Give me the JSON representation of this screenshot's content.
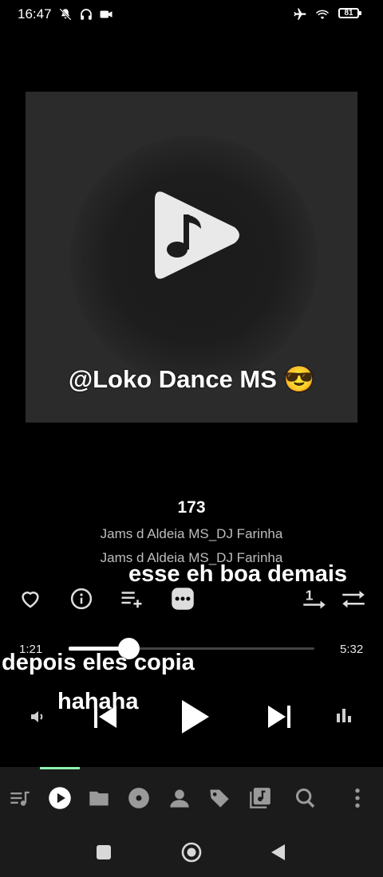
{
  "status_bar": {
    "time": "16:47",
    "battery": "81",
    "icons": [
      "mute-icon",
      "headphones-icon",
      "camera-icon",
      "airplane-icon",
      "wifi-icon",
      "battery-icon"
    ]
  },
  "artwork": {
    "caption": "@Loko Dance MS 😎",
    "background": "#2b2b2b",
    "icon": "music-play-icon"
  },
  "track": {
    "title": "173",
    "artist": "Jams d Aldeia MS_DJ Farinha",
    "album": "Jams d Aldeia MS_DJ Farinha"
  },
  "overlays": {
    "text1": "esse eh boa demais",
    "text2": "depois eles copia",
    "text3": "hahaha"
  },
  "actions": {
    "icons": [
      "heart-icon",
      "info-icon",
      "playlist-add-icon",
      "more-icon",
      "repeat-one-icon",
      "shuffle-icon"
    ],
    "repeat_badge": "1"
  },
  "seek": {
    "elapsed": "1:21",
    "total": "5:32",
    "progress": 0.244
  },
  "playback": {
    "icons": [
      "volume-icon",
      "previous-icon",
      "play-icon",
      "next-icon",
      "equalizer-icon"
    ]
  },
  "bottom_nav": {
    "active_index": 1,
    "accent": "#8ff2b0",
    "items": [
      "queue-icon",
      "now-playing-icon",
      "folder-icon",
      "album-icon",
      "artist-icon",
      "tag-icon",
      "library-icon",
      "search-icon",
      "menu-icon"
    ]
  },
  "system_nav": [
    "recents-button",
    "home-button",
    "back-button"
  ]
}
